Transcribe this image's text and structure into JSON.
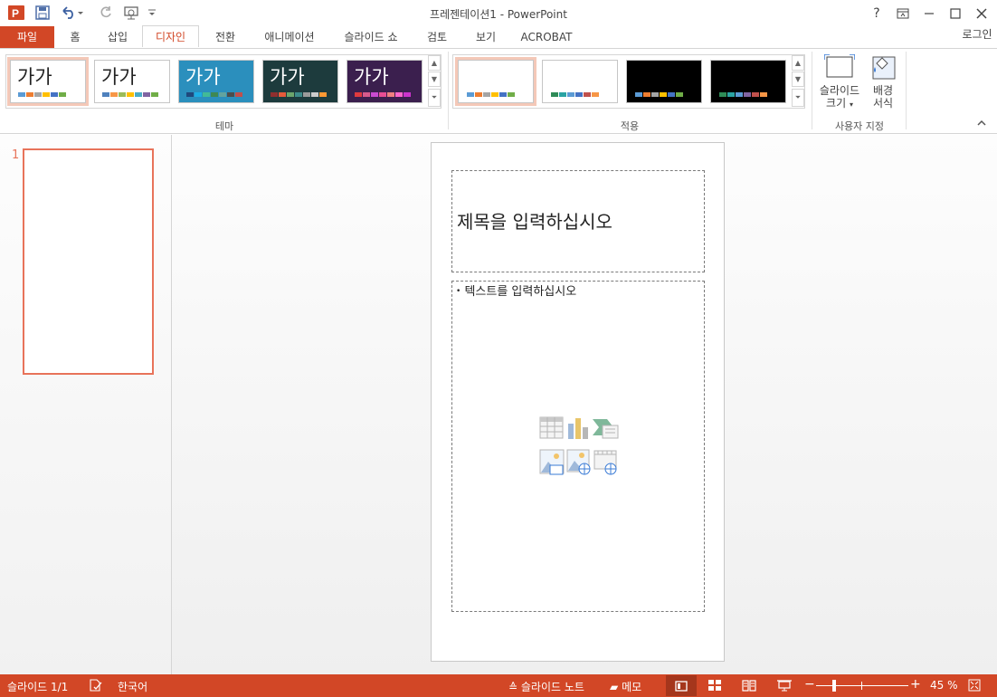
{
  "window": {
    "title": "프레젠테이션1 - PowerPoint",
    "help": "?",
    "login": "로그인"
  },
  "tabs": [
    {
      "label": "파일"
    },
    {
      "label": "홈"
    },
    {
      "label": "삽입"
    },
    {
      "label": "디자인"
    },
    {
      "label": "전환"
    },
    {
      "label": "애니메이션"
    },
    {
      "label": "슬라이드 쇼"
    },
    {
      "label": "검토"
    },
    {
      "label": "보기"
    },
    {
      "label": "ACROBAT"
    }
  ],
  "ribbon": {
    "themes": {
      "group_label": "테마",
      "items": [
        {
          "sample": "가가",
          "bg": "#ffffff",
          "text_color": "#222222",
          "colors": [
            "#5b9bd5",
            "#ed7d31",
            "#a5a5a5",
            "#ffc000",
            "#4472c4",
            "#70ad47"
          ]
        },
        {
          "sample": "가가",
          "bg": "#ffffff",
          "text_color": "#222222",
          "colors": [
            "#4f81bd",
            "#f79646",
            "#9bbb59",
            "#ffc000",
            "#4bacc6",
            "#8064a2",
            "#70ad47"
          ]
        },
        {
          "sample": "가가",
          "bg": "#2b8fbd",
          "text_color": "#ffffff",
          "colors": [
            "#1f497d",
            "#1cade4",
            "#42ba97",
            "#3e8853",
            "#62a39f",
            "#4d4d4d",
            "#c0504d"
          ]
        },
        {
          "sample": "가가",
          "bg": "#1d3b3d",
          "text_color": "#ffffff",
          "colors": [
            "#8f2f2f",
            "#e65b3b",
            "#6ca66c",
            "#3d8b8b",
            "#9b9b9b",
            "#cccccc",
            "#ff9933"
          ]
        },
        {
          "sample": "가가",
          "bg": "#3b1f4e",
          "text_color": "#ffffff",
          "colors": [
            "#e03a3e",
            "#d65a8c",
            "#c94bd1",
            "#e84e94",
            "#f08080",
            "#ff66cc",
            "#cc33cc"
          ]
        }
      ]
    },
    "variants": {
      "group_label": "적용",
      "items": [
        {
          "bg": "#ffffff",
          "colors": [
            "#5b9bd5",
            "#ed7d31",
            "#a5a5a5",
            "#ffc000",
            "#4472c4",
            "#70ad47"
          ]
        },
        {
          "bg": "#ffffff",
          "colors": [
            "#2e8b57",
            "#29a3a3",
            "#5b9bd5",
            "#4472c4",
            "#c0504d",
            "#f79646"
          ]
        },
        {
          "bg": "#000000",
          "colors": [
            "#5b9bd5",
            "#ed7d31",
            "#a5a5a5",
            "#ffc000",
            "#4472c4",
            "#70ad47"
          ]
        },
        {
          "bg": "#000000",
          "colors": [
            "#2e8b57",
            "#29a3a3",
            "#5b9bd5",
            "#8064a2",
            "#c0504d",
            "#f79646"
          ]
        }
      ]
    },
    "customize": {
      "group_label": "사용자 지정",
      "slide_size_line1": "슬라이드",
      "slide_size_line2": "크기",
      "background_line1": "배경",
      "background_line2": "서식"
    }
  },
  "thumbnails": [
    {
      "number": "1"
    }
  ],
  "slide": {
    "title_placeholder": "제목을 입력하십시오",
    "content_placeholder": "텍스트를 입력하십시오"
  },
  "statusbar": {
    "slide_counter": "슬라이드 1/1",
    "language": "한국어",
    "notes": "슬라이드 노트",
    "comments": "메모",
    "zoom": "45 %",
    "zoom_fraction": 0.45
  },
  "colors": {
    "accent": "#d24726",
    "thumb_border": "#e8735a"
  }
}
